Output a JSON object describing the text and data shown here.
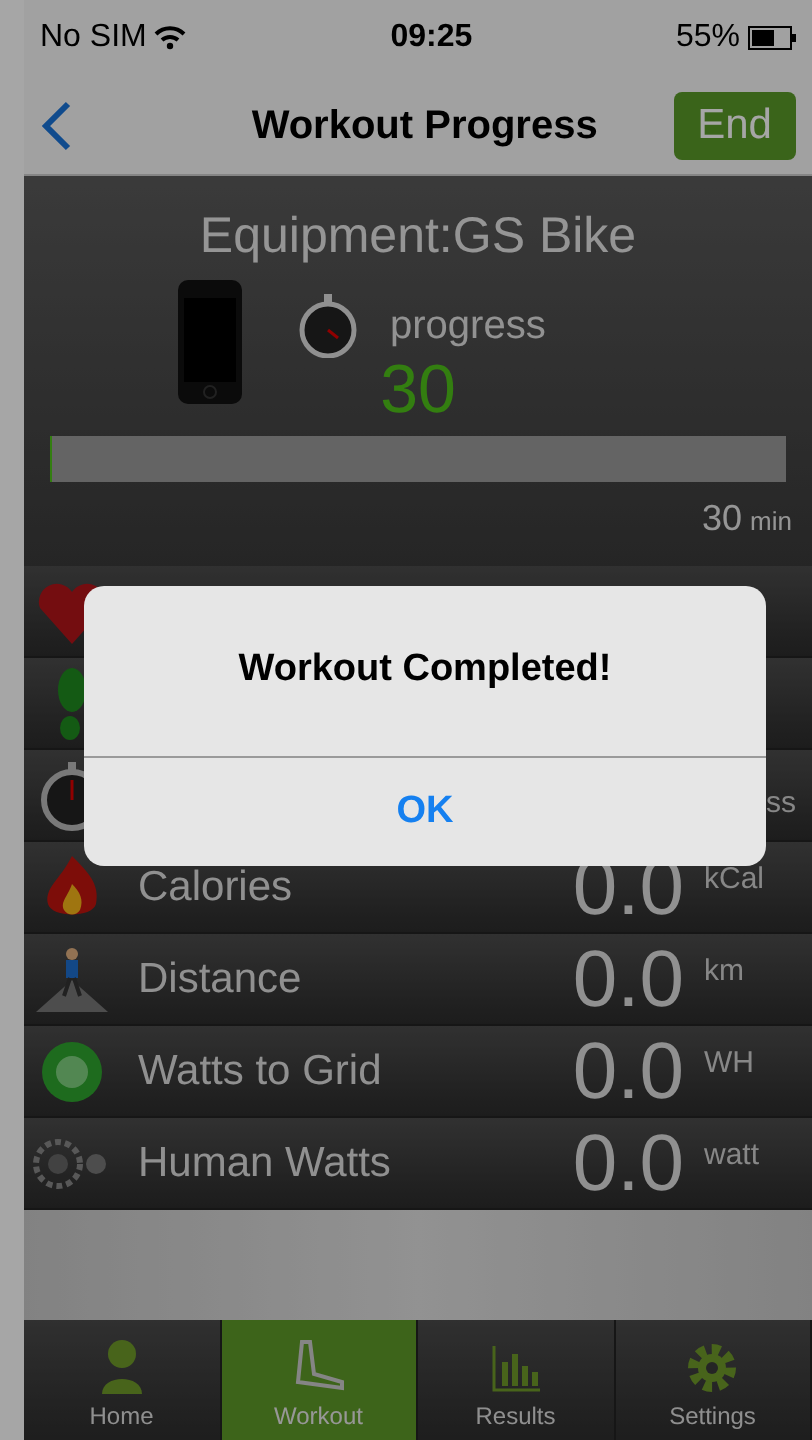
{
  "status_bar": {
    "carrier": "No SIM",
    "time": "09:25",
    "battery": "55%"
  },
  "nav": {
    "title": "Workout Progress",
    "end_button": "End"
  },
  "equipment": {
    "title": "Equipment:GS Bike",
    "progress_label": "progress",
    "value": "30",
    "level": 0,
    "reading": "30",
    "reading_unit": "min"
  },
  "metrics": [
    {
      "kind": "heart"
    },
    {
      "kind": "steps"
    },
    {
      "kind": "stopwatch",
      "unit": "ss"
    },
    {
      "kind": "calories",
      "label": "Calories",
      "value": "0.0",
      "unit": "kCal"
    },
    {
      "kind": "distance",
      "label": "Distance",
      "value": "0.0",
      "unit": "km"
    },
    {
      "kind": "grid",
      "label": "Watts to Grid",
      "value": "0.0",
      "unit": "WH"
    },
    {
      "kind": "gear",
      "label": "Human Watts",
      "value": "0.0",
      "unit": "watt"
    }
  ],
  "tabs": [
    {
      "label": "Home",
      "kind": "home",
      "selected": false
    },
    {
      "label": "Workout",
      "kind": "workout",
      "selected": true
    },
    {
      "label": "Results",
      "kind": "results",
      "selected": false
    },
    {
      "label": "Settings",
      "kind": "settings",
      "selected": false
    }
  ],
  "alert": {
    "title": "Workout Completed!",
    "button": "OK"
  }
}
